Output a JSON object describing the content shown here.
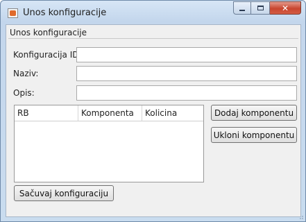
{
  "window": {
    "title": "Unos konfiguracije",
    "controls": {
      "minimize": "minimize-icon",
      "maximize": "maximize-icon",
      "close": "close-icon"
    }
  },
  "form": {
    "group_title": "Unos konfiguracije",
    "fields": {
      "config_id": {
        "label": "Konfiguracija ID:",
        "value": ""
      },
      "name": {
        "label": "Naziv:",
        "value": ""
      },
      "description": {
        "label": "Opis:",
        "value": ""
      }
    },
    "table": {
      "columns": [
        "RB",
        "Komponenta",
        "Kolicina"
      ],
      "rows": []
    },
    "buttons": {
      "add_component": "Dodaj komponentu",
      "remove_component": "Ukloni komponentu",
      "save_configuration": "Sačuvaj konfiguraciju"
    }
  },
  "colors": {
    "title_bar": "#c3d6ec",
    "close_button": "#c8462f",
    "client_background": "#f0f0f0"
  }
}
